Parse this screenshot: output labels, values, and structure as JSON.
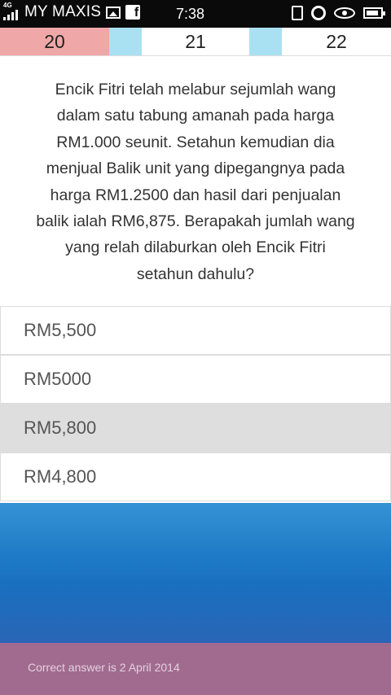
{
  "status_bar": {
    "network_type": "4G",
    "carrier": "MY MAXIS",
    "time": "7:38",
    "fb_glyph": "f"
  },
  "pager": {
    "items": [
      {
        "label": "20",
        "color": "#f0a7a7"
      },
      {
        "label": "21",
        "color": "#ffffff"
      },
      {
        "label": "22",
        "color": "#ffffff"
      }
    ],
    "gap_color": "#a9e1f3"
  },
  "question": {
    "lines": [
      "Encik Fitri telah melabur sejumlah wang",
      "dalam satu tabung amanah pada harga",
      "RM1.000 seunit. Setahun kemudian dia",
      "menjual Balik unit yang dipegangnya pada",
      "harga RM1.2500 dan hasil dari penjualan",
      "balik ialah RM6,875. Berapakah jumlah wang",
      "yang relah dilaburkan oleh Encik Fitri",
      "setahun dahulu?"
    ]
  },
  "options": [
    {
      "label": "RM5,500",
      "selected": false
    },
    {
      "label": "RM5000",
      "selected": false
    },
    {
      "label": "RM5,800",
      "selected": true
    },
    {
      "label": "RM4,800",
      "selected": false
    }
  ],
  "footer": {
    "text": "Correct answer is 2 April 2014",
    "color": "#a16b8f"
  }
}
